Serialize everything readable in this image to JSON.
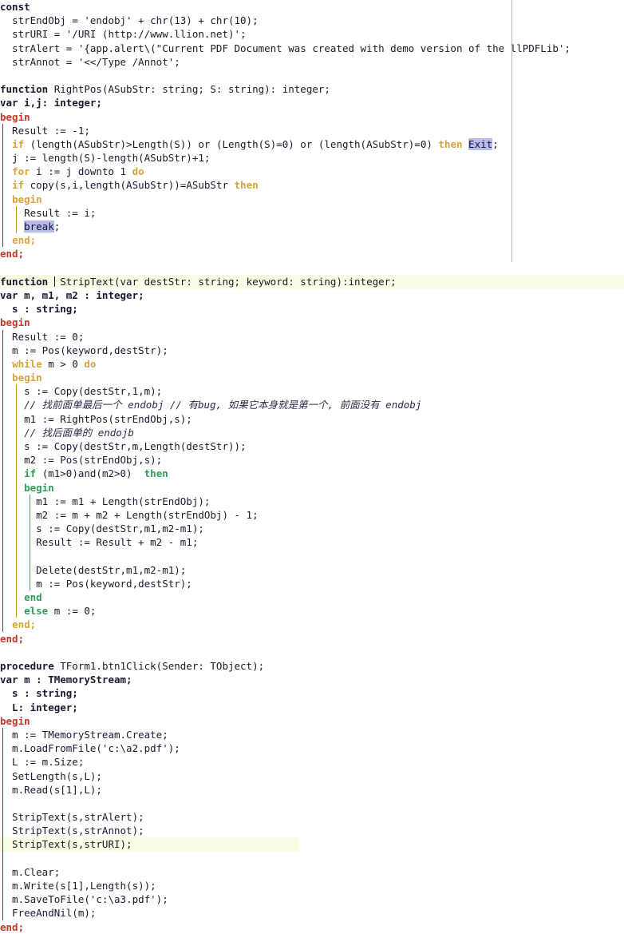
{
  "editor": {
    "language": "Delphi / Object Pascal",
    "margin_ruler_column": 78,
    "colors": {
      "background": "#ffffff",
      "text": "#1a1a2e",
      "keyword_amber": "#d6a43c",
      "keyword_red": "#c0392b",
      "keyword_green": "#2e9e57",
      "comment": "#2b2b4a",
      "selection": "#b9bce8",
      "current_line_highlight": "#fcfbe3",
      "guide_outer": "#9e2b2b",
      "guide_amber": "#c9962e",
      "guide_green": "#3a9b5c",
      "margin_ruler": "#b9b9c2"
    }
  },
  "code": {
    "l1": "const",
    "l2": "  strEndObj = 'endobj' + chr(13) + chr(10);",
    "l3": "  strURI = '/URI (http://www.llion.net)';",
    "l4a": "  strAlert = '{app.alert\\(\"Current PDF Document was created with demo version of the llPDFLib';",
    "l5": "  strAnnot = '<</Type /Annot';",
    "l6": "function",
    "l6b": " RightPos(ASubStr: string; S: string): integer;",
    "l7": "var i,j: integer;",
    "l8": "begin",
    "l9": "  Result := -1;",
    "l10a": "if",
    "l10b": " (length(ASubStr)>Length(S)) or (Length(S)=0) or (length(ASubStr)=0) ",
    "l10c": "then",
    "l10d": " ",
    "l10e": "Exit",
    "l10f": ";",
    "l11": "  j := length(S)-length(ASubStr)+1;",
    "l12a": "for",
    "l12b": " i := j downto 1 ",
    "l12c": "do",
    "l13a": "if",
    "l13b": " copy(s,i,length(ASubStr))=ASubStr ",
    "l13c": "then",
    "l14": "begin",
    "l15": "    Result := i;",
    "l16": "break",
    "l16b": ";",
    "l17": "end;",
    "l18": "end;",
    "l19a": "function",
    "l19b": " StripText(var destStr: string; keyword: string):integer;",
    "l20": "var m, m1, m2 : integer;",
    "l21": "  s : string;",
    "l22": "begin",
    "l23": "  Result := 0;",
    "l24": "  m := Pos(keyword,destStr);",
    "l25a": "while",
    "l25b": " m > 0 ",
    "l25c": "do",
    "l26": "begin",
    "l27": "    s := Copy(destStr,1,m);",
    "l28": "// 找前面单最后一个 endobj // 有bug, 如果它本身就是第一个, 前面没有 endobj",
    "l29": "    m1 := RightPos(strEndObj,s);",
    "l30": "// 找后面单的 endojb",
    "l31": "    s := Copy(destStr,m,Length(destStr));",
    "l32": "    m2 := Pos(strEndObj,s);",
    "l33a": "if",
    "l33b": " (m1>0)and(m2>0)  ",
    "l33c": "then",
    "l34": "begin",
    "l35": "      m1 := m1 + Length(strEndObj);",
    "l36": "      m2 := m + m2 + Length(strEndObj) - 1;",
    "l37": "      s := Copy(destStr,m1,m2-m1);",
    "l38": "      Result := Result + m2 - m1;",
    "l39": "      Delete(destStr,m1,m2-m1);",
    "l40": "      m := Pos(keyword,destStr);",
    "l41": "end",
    "l42a": "else",
    "l42b": " m := 0;",
    "l43": "end;",
    "l44": "end;",
    "l45a": "procedure",
    "l45b": " TForm1.btn1Click(Sender: TObject);",
    "l46": "var m : TMemoryStream;",
    "l47": "  s : string;",
    "l48": "  L: integer;",
    "l49": "begin",
    "l50": "  m := TMemoryStream.Create;",
    "l51": "  m.LoadFromFile('c:\\a2.pdf');",
    "l52": "  L := m.Size;",
    "l53": "  SetLength(s,L);",
    "l54": "  m.Read(s[1],L);",
    "l55": "  StripText(s,strAlert);",
    "l56": "  StripText(s,strAnnot);",
    "l57": "  StripText(s,strURI);",
    "l58": "  m.Clear;",
    "l59": "  m.Write(s[1],Length(s));",
    "l60": "  m.SaveToFile('c:\\a3.pdf');",
    "l61": "  FreeAndNil(m);",
    "l62": "end;"
  }
}
